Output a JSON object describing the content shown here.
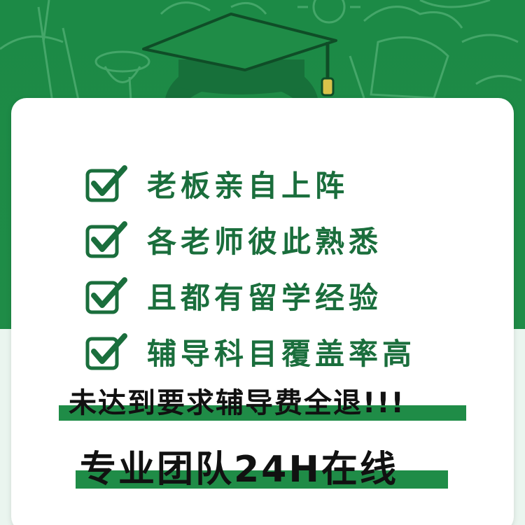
{
  "features": [
    {
      "icon": "checkbox-checked-icon",
      "label": "老板亲自上阵"
    },
    {
      "icon": "checkbox-checked-icon",
      "label": "各老师彼此熟悉"
    },
    {
      "icon": "checkbox-checked-icon",
      "label": "且都有留学经验"
    },
    {
      "icon": "checkbox-checked-icon",
      "label": "辅导科目覆盖率高"
    }
  ],
  "refund_text": "未达到要求辅导费全退!!!",
  "team_text": "专业团队24H在线",
  "colors": {
    "brand_green": "#1f8c47",
    "text_green": "#1a6e3c",
    "dark_text": "#111111"
  }
}
